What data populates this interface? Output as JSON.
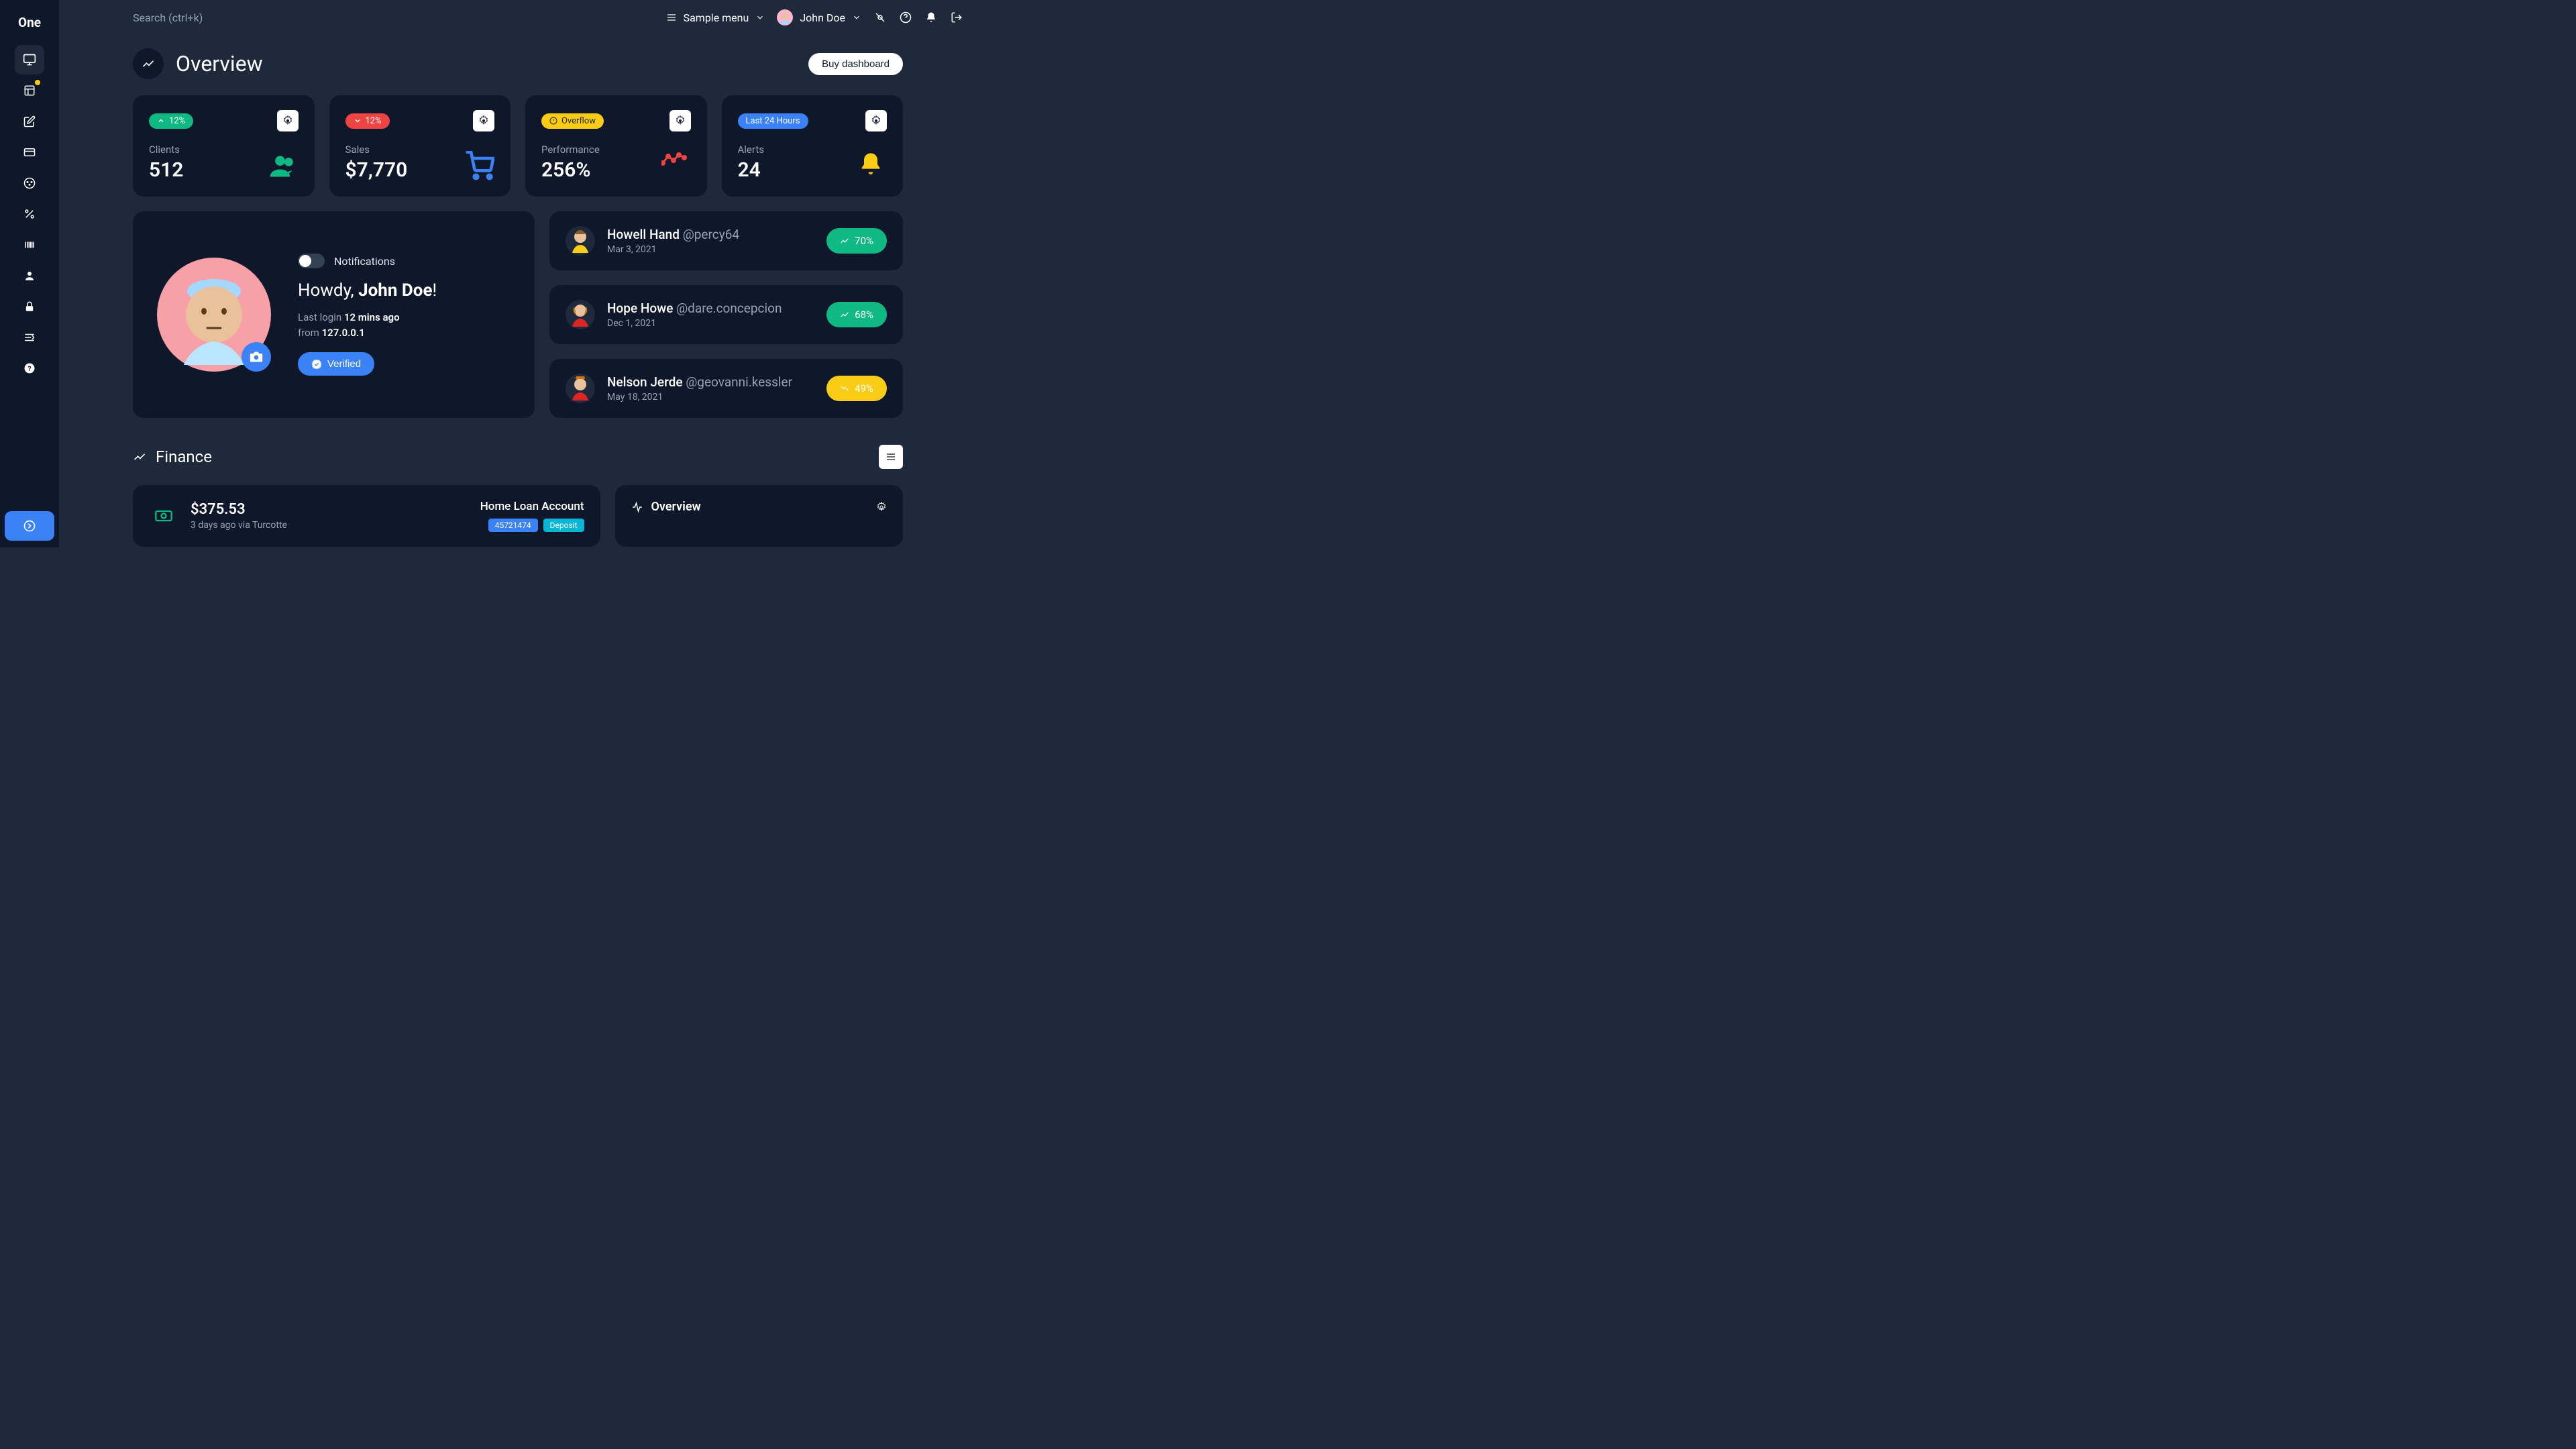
{
  "brand": "One",
  "search_placeholder": "Search (ctrl+k)",
  "topbar": {
    "sample_menu_label": "Sample menu",
    "user_name": "John Doe"
  },
  "page": {
    "title": "Overview",
    "buy_label": "Buy dashboard"
  },
  "stats": {
    "clients": {
      "pill": "12%",
      "label": "Clients",
      "value": "512"
    },
    "sales": {
      "pill": "12%",
      "label": "Sales",
      "value": "$7,770"
    },
    "performance": {
      "pill": "Overflow",
      "label": "Performance",
      "value": "256%"
    },
    "alerts": {
      "pill": "Last 24 Hours",
      "label": "Alerts",
      "value": "24"
    }
  },
  "profile": {
    "notifications_label": "Notifications",
    "greeting_prefix": "Howdy, ",
    "greeting_name": "John Doe",
    "greeting_suffix": "!",
    "last_login_prefix": "Last login ",
    "last_login_time": "12 mins ago",
    "last_login_from_prefix": "from ",
    "last_login_ip": "127.0.0.1",
    "verified_label": "Verified"
  },
  "users": [
    {
      "name": "Howell Hand",
      "handle": "@percy64",
      "date": "Mar 3, 2021",
      "pct": "70%",
      "color": "#10b981"
    },
    {
      "name": "Hope Howe",
      "handle": "@dare.concepcion",
      "date": "Dec 1, 2021",
      "pct": "68%",
      "color": "#10b981"
    },
    {
      "name": "Nelson Jerde",
      "handle": "@geovanni.kessler",
      "date": "May 18, 2021",
      "pct": "49%",
      "color": "#facc15"
    }
  ],
  "finance": {
    "section_title": "Finance",
    "amount": "$375.53",
    "meta": "3 days ago via Turcotte",
    "account_name": "Home Loan Account",
    "account_number": "45721474",
    "account_type": "Deposit",
    "overview_label": "Overview"
  },
  "colors": {
    "green": "#10b981",
    "red": "#ef4444",
    "yellow": "#facc15",
    "blue": "#3b82f6"
  }
}
